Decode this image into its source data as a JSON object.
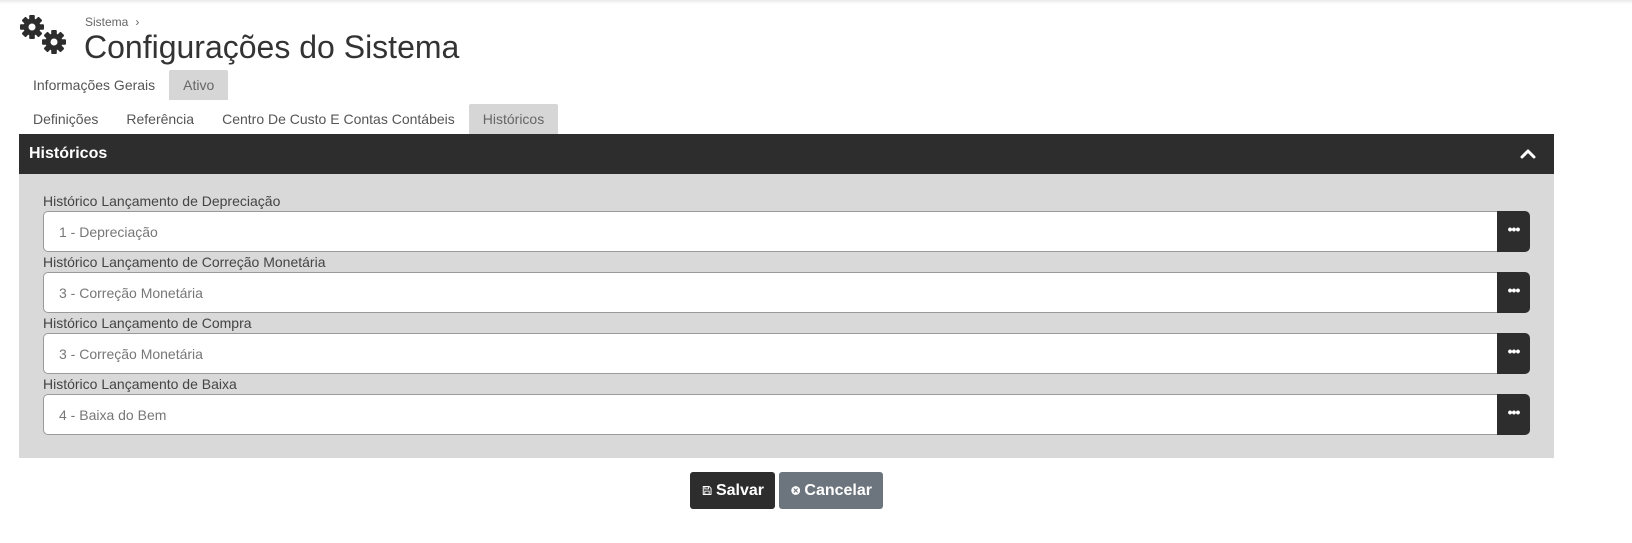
{
  "breadcrumb": {
    "parent": "Sistema",
    "separator": "›"
  },
  "page": {
    "title": "Configurações do Sistema"
  },
  "tabs_primary": [
    {
      "label": "Informações Gerais"
    },
    {
      "label": "Ativo"
    }
  ],
  "tabs_secondary": [
    {
      "label": "Definições"
    },
    {
      "label": "Referência"
    },
    {
      "label": "Centro De Custo E Contas Contábeis"
    },
    {
      "label": "Históricos"
    }
  ],
  "active_tabs": {
    "primary": "Ativo",
    "secondary": "Históricos"
  },
  "panel": {
    "title": "Históricos"
  },
  "fields": [
    {
      "label": "Histórico Lançamento de Depreciação",
      "value": "1 - Depreciação"
    },
    {
      "label": "Histórico Lançamento de Correção Monetária",
      "value": "3 - Correção Monetária"
    },
    {
      "label": "Histórico Lançamento de Compra",
      "value": "3 - Correção Monetária"
    },
    {
      "label": "Histórico Lançamento de Baixa",
      "value": "4 - Baixa do Bem"
    }
  ],
  "lookup_button_glyph": "•••",
  "actions": {
    "save_label": "Salvar",
    "cancel_label": "Cancelar"
  },
  "icons": {
    "header": "gears-icon",
    "collapse": "chevron-up-icon",
    "lookup": "ellipsis-icon",
    "save": "floppy-disk-icon",
    "cancel": "circle-x-icon"
  },
  "colors": {
    "dark": "#2d2d2d",
    "panel_bg": "#d9d9d9",
    "tab_active_bg": "#d6d6d6",
    "cancel_bg": "#6c757d"
  }
}
